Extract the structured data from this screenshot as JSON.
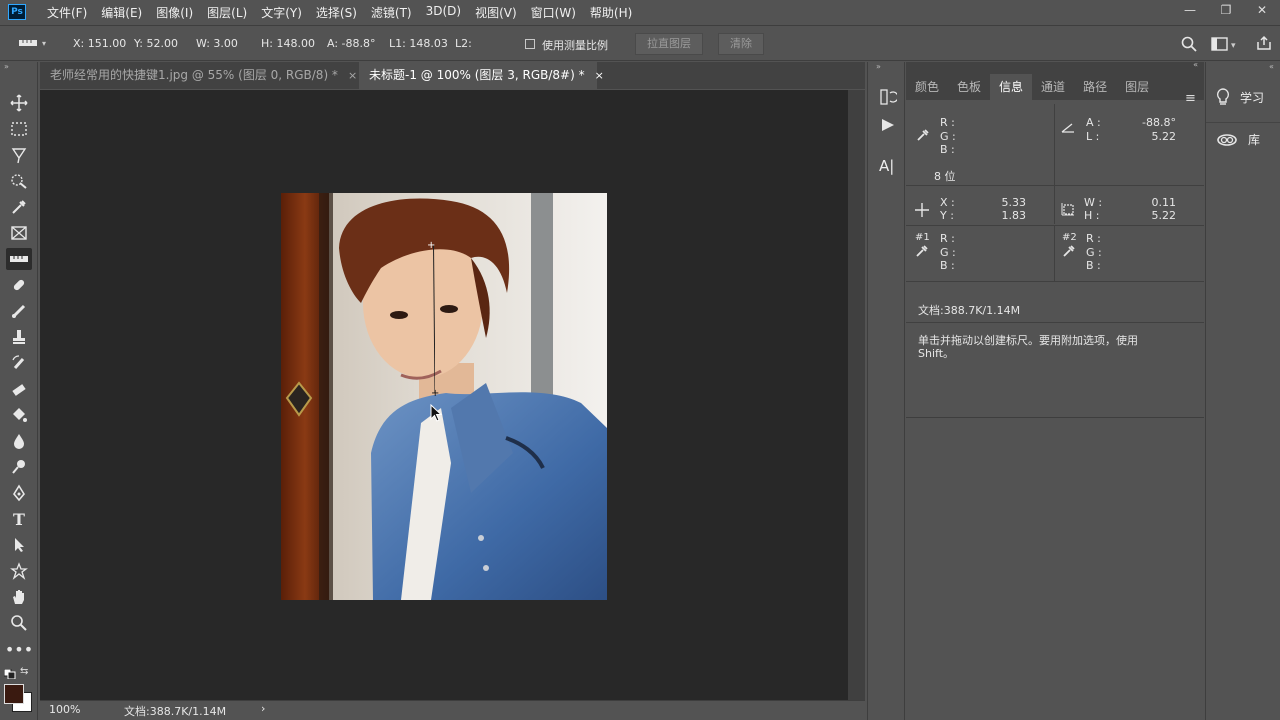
{
  "app": {
    "logo_text": "Ps"
  },
  "menu": [
    "文件(F)",
    "编辑(E)",
    "图像(I)",
    "图层(L)",
    "文字(Y)",
    "选择(S)",
    "滤镜(T)",
    "3D(D)",
    "视图(V)",
    "窗口(W)",
    "帮助(H)"
  ],
  "window_controls": {
    "minimize": "—",
    "restore": "❐",
    "close": "✕"
  },
  "options": {
    "x": "X: 151.00",
    "y": "Y: 52.00",
    "w": "W: 3.00",
    "h": "H: 148.00",
    "a": "A: -88.8°",
    "l1": "L1: 148.03",
    "l2": "L2:",
    "use_scale_label": "使用测量比例",
    "straighten_label": "拉直图层",
    "clear_label": "清除"
  },
  "tabs": [
    {
      "label": "老师经常用的快捷键1.jpg @ 55% (图层 0, RGB/8) *",
      "close": "×"
    },
    {
      "label": "未标题-1 @ 100% (图层 3, RGB/8#) *",
      "close": "×"
    }
  ],
  "status": {
    "zoom": "100%",
    "doc": "文档:388.7K/1.14M",
    "arrow": "›"
  },
  "panel": {
    "tabs": [
      "颜色",
      "色板",
      "信息",
      "通道",
      "路径",
      "图层"
    ],
    "active_tab": "信息",
    "info": {
      "rgb1": {
        "r": "R :",
        "g": "G :",
        "b": "B :"
      },
      "bit": "8 位",
      "angle": {
        "a_label": "A :",
        "a_value": "-88.8°",
        "l_label": "L :",
        "l_value": "5.22"
      },
      "xy": {
        "x_label": "X :",
        "x_value": "5.33",
        "y_label": "Y :",
        "y_value": "1.83"
      },
      "wh": {
        "w_label": "W :",
        "w_value": "0.11",
        "h_label": "H :",
        "h_value": "5.22"
      },
      "sample1": {
        "tag": "#1",
        "r": "R :",
        "g": "G :",
        "b": "B :"
      },
      "sample2": {
        "tag": "#2",
        "r": "R :",
        "g": "G :",
        "b": "B :"
      },
      "doc": "文档:388.7K/1.14M",
      "hint_line1": "单击并拖动以创建标尺。要用附加选项，使用",
      "hint_line2": "Shift。"
    }
  },
  "right_panel": {
    "learn": "学习",
    "library": "库"
  },
  "colors": {
    "foreground": "#3a1a10",
    "background": "#ffffff",
    "accent": "#31a8ff"
  }
}
